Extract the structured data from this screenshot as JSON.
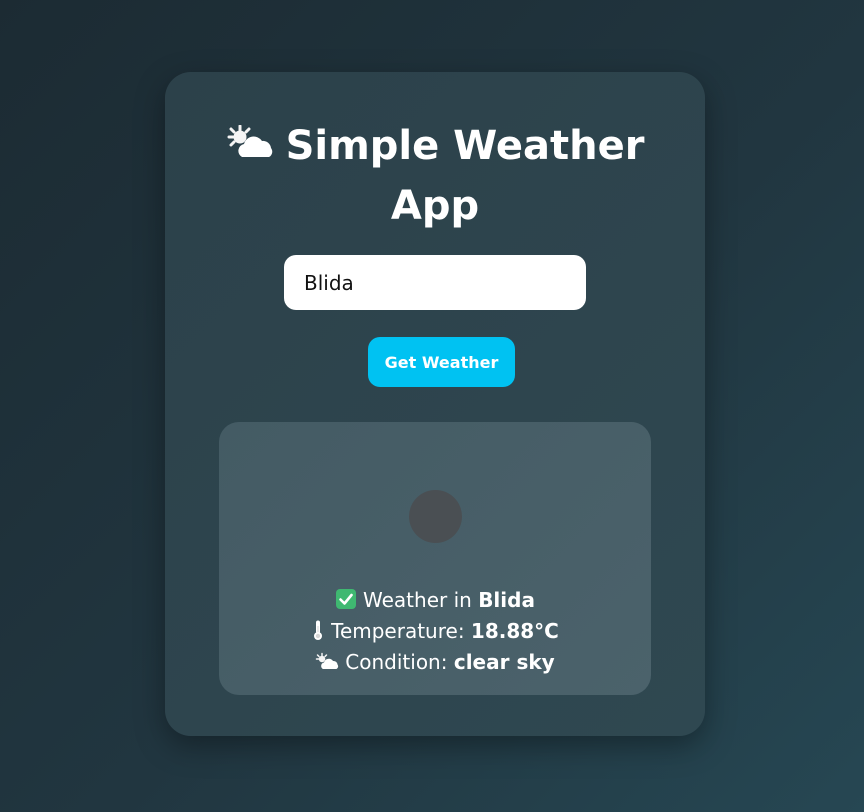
{
  "app": {
    "title_line1": "Simple Weather",
    "title_line2": "App",
    "title_icon": "sun-behind-cloud-icon"
  },
  "search": {
    "value": "Blida",
    "placeholder": "Enter city"
  },
  "actions": {
    "get_weather_label": "Get Weather"
  },
  "result": {
    "weather_prefix": "Weather in",
    "city": "Blida",
    "temperature_prefix": "Temperature:",
    "temperature_value": "18.88°C",
    "condition_prefix": "Condition:",
    "condition_value": "clear sky",
    "icons": [
      "check-mark-icon",
      "thermometer-icon",
      "sun-behind-cloud-icon"
    ]
  },
  "colors": {
    "accent": "#00c2f2",
    "card_bg": "#2e444d",
    "result_bg": "#475e67",
    "check_green": "#3fb871"
  }
}
